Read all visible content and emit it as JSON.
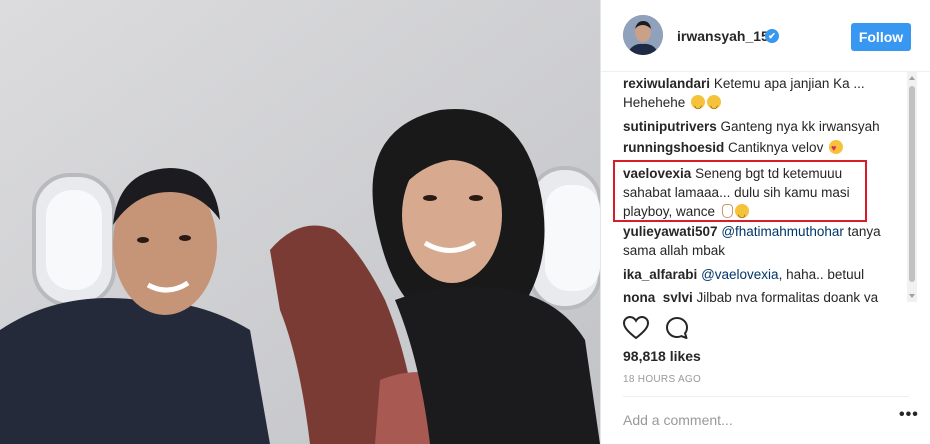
{
  "post": {
    "username": "irwansyah_15",
    "verified_icon": "✔",
    "follow_label": "Follow",
    "likes": "98,818 likes",
    "time": "18 HOURS AGO",
    "add_comment_placeholder": "Add a comment...",
    "more_label": "•••"
  },
  "comments": [
    {
      "user": "rexiwulandari",
      "text": "Ketemu apa janjian Ka ... Hehehehe"
    },
    {
      "user": "sutiniputrivers",
      "text": "Ganteng nya kk irwansyah"
    },
    {
      "user": "runningshoesid",
      "text": "Cantiknya velov"
    },
    {
      "user": "vaelovexia",
      "text": "Seneng bgt td ketemuuu sahabat lamaaa... dulu sih kamu masi playboy, wance"
    },
    {
      "user": "yulieyawati507",
      "mention": "@fhatimahmuthohar",
      "text": "tanya sama allah mbak"
    },
    {
      "user": "ika_alfarabi",
      "mention": "@vaelovexia",
      "text": ", haha.. betuul"
    },
    {
      "user": "nona_sylvi",
      "text": "Jilbab nya formalitas doank ya"
    }
  ],
  "colors": {
    "accent": "#3897f0",
    "highlight": "#d91c2a"
  }
}
